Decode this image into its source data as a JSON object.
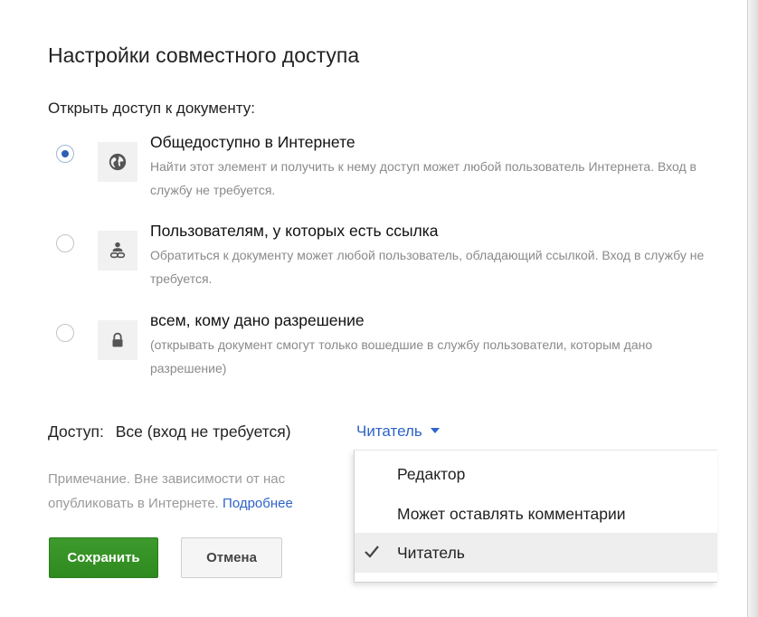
{
  "dialog": {
    "title": "Настройки совместного доступа",
    "section_label": "Открыть доступ к документу:"
  },
  "options": [
    {
      "title": "Общедоступно в Интернете",
      "description": "Найти этот элемент и получить к нему доступ может любой пользователь Интернета. Вход в службу не требуется.",
      "icon": "globe-icon",
      "selected": true
    },
    {
      "title": "Пользователям, у которых есть ссылка",
      "description": "Обратиться к документу может любой пользователь, обладающий ссылкой. Вход в службу не требуется.",
      "icon": "person-link-icon",
      "selected": false
    },
    {
      "title": "всем, кому дано разрешение",
      "description": "(открывать документ смогут только вошедшие в службу пользователи, которым дано разрешение)",
      "icon": "lock-icon",
      "selected": false
    }
  ],
  "access": {
    "label": "Доступ:",
    "value": "Все (вход не требуется)",
    "role": "Читатель"
  },
  "note": {
    "line1": "Примечание. Вне зависимости от нас",
    "line2": "опубликовать в Интернете.",
    "link": "Подробнее"
  },
  "buttons": {
    "save": "Сохранить",
    "cancel": "Отмена"
  },
  "menu": {
    "items": [
      {
        "label": "Редактор",
        "checked": false
      },
      {
        "label": "Может оставлять комментарии",
        "checked": false
      },
      {
        "label": "Читатель",
        "checked": true
      }
    ]
  },
  "colors": {
    "primary_button": "#35911f",
    "link": "#2d63c8",
    "radio_selected": "#2d5fb3",
    "muted_text": "#8a8a8a"
  }
}
